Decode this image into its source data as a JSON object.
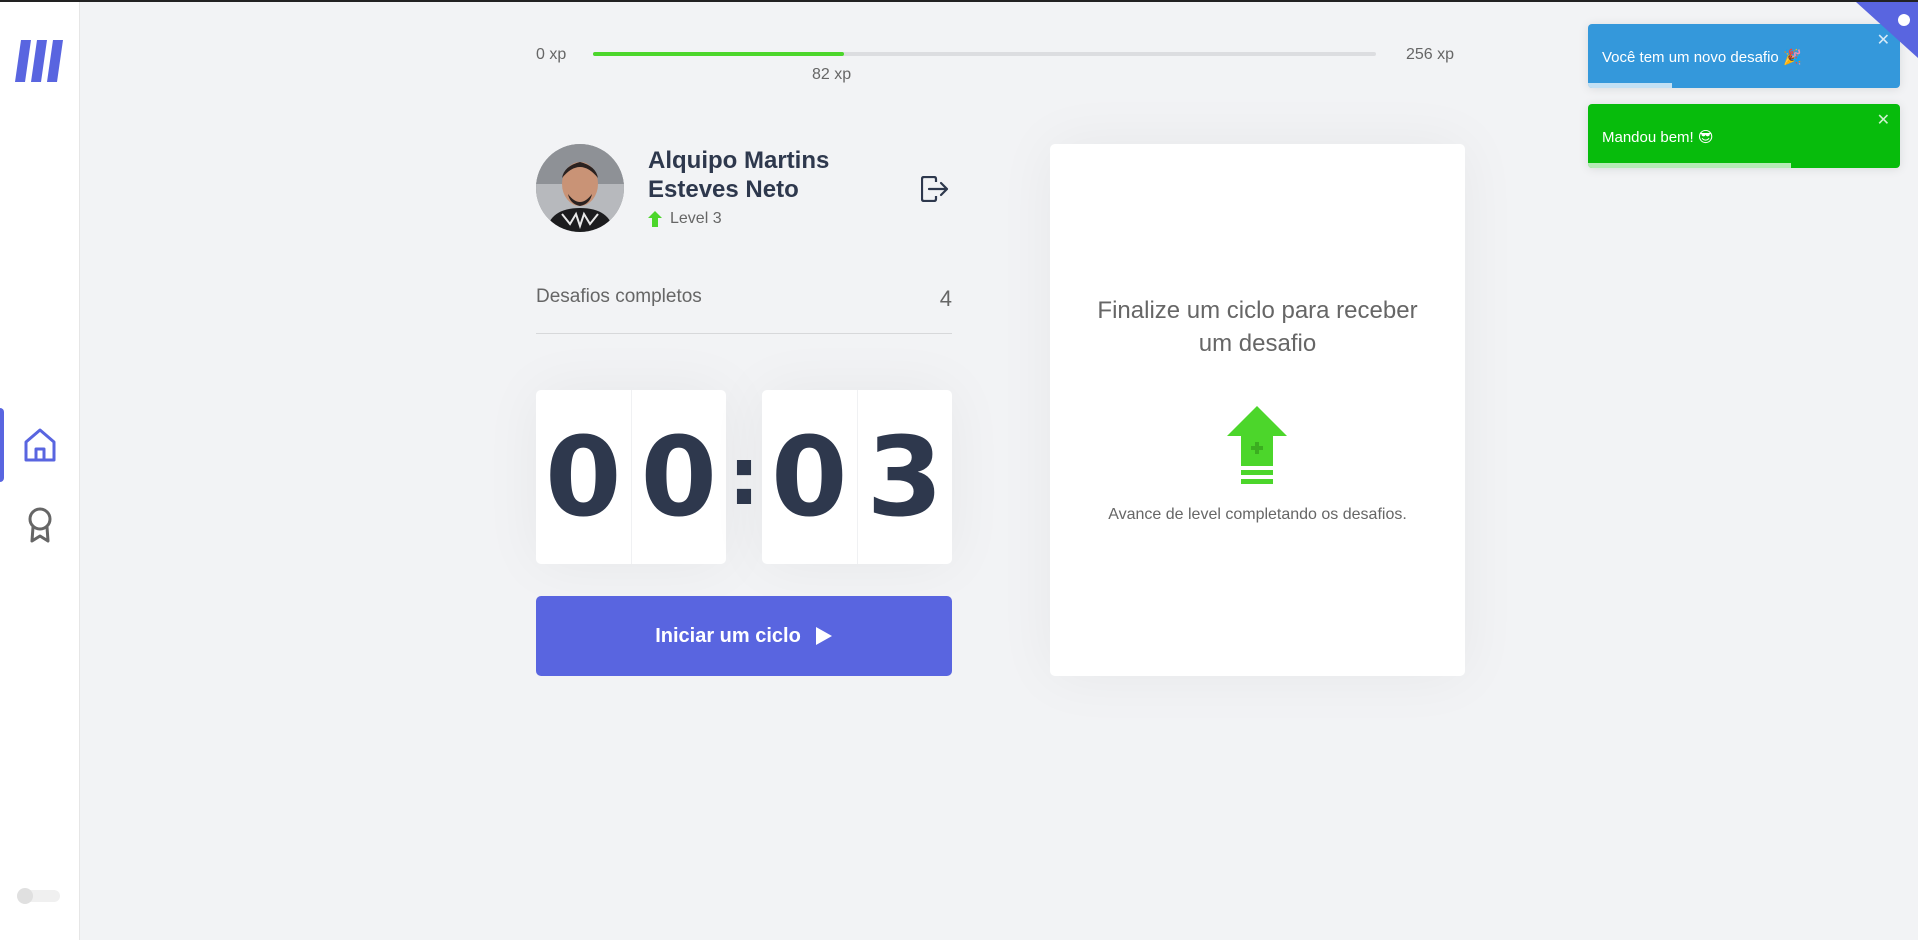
{
  "sidebar": {
    "nav": [
      {
        "icon": "home-icon",
        "active": true
      },
      {
        "icon": "award-icon",
        "active": false
      }
    ]
  },
  "xp": {
    "min_label": "0 xp",
    "max_label": "256 xp",
    "current_label": "82 xp",
    "progress_fraction": 0.32
  },
  "profile": {
    "name": "Alquipo Martins Esteves Neto",
    "level_label": "Level 3"
  },
  "completed_challenges": {
    "label": "Desafios completos",
    "count": "4"
  },
  "countdown": {
    "minutes": [
      "0",
      "0"
    ],
    "separator": ":",
    "seconds": [
      "0",
      "3"
    ]
  },
  "start_button": {
    "label": "Iniciar um ciclo"
  },
  "challenge_box": {
    "title": "Finalize um ciclo para receber um desafio",
    "hint": "Avance de level completando os desafios."
  },
  "toasts": [
    {
      "type": "info",
      "text": "Você tem um novo desafio 🎉",
      "close": "✕",
      "progress_fraction": 0.27
    },
    {
      "type": "success",
      "text": "Mandou bem! 😎",
      "close": "✕",
      "progress_fraction": 0.65
    }
  ],
  "colors": {
    "accent": "#5965E0",
    "green": "#4CD62B",
    "text_title": "#2E384D",
    "text": "#666666",
    "background": "#F2F3F5",
    "toast_info": "#3498DB",
    "toast_success": "#07BC0C"
  }
}
